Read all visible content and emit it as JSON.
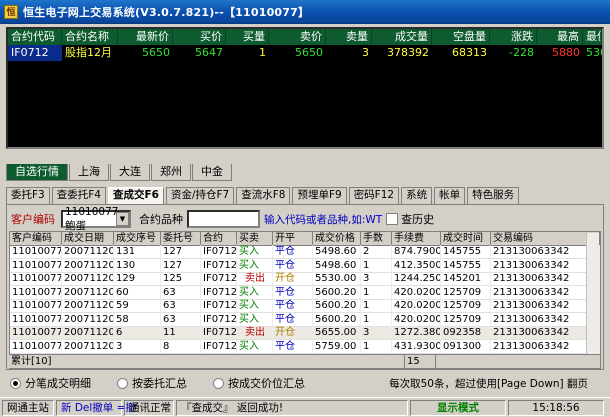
{
  "window": {
    "title": "恒生电子网上交易系统(V3.0.7.821)--【11010077】"
  },
  "quote": {
    "headers": [
      "合约代码",
      "合约名称",
      "最新价",
      "买价",
      "买量",
      "卖价",
      "卖量",
      "成交量",
      "空盘量",
      "涨跌",
      "最高",
      "最低"
    ],
    "row": {
      "code": "IF0712",
      "name": "股指12月",
      "last": "5650",
      "bid": "5647",
      "bid_vol": "1",
      "ask": "5650",
      "ask_vol": "3",
      "volume": "378392",
      "oi": "68313",
      "change": "-228",
      "high": "5880",
      "low": "5305"
    }
  },
  "market_tabs": [
    "自选行情",
    "上海",
    "大连",
    "郑州",
    "中金"
  ],
  "func_tabs": [
    "委托F3",
    "查委托F4",
    "查成交F6",
    "资金/持仓F7",
    "查流水F8",
    "预埋单F9",
    "密码F12",
    "系统",
    "帐单",
    "特色服务"
  ],
  "filter": {
    "customer_label": "客户编码",
    "customer_value": "11010077 鲍蛋",
    "contract_label": "合约品种",
    "contract_value": "",
    "hint": "输入代码或者品种,如:WT",
    "history_label": "查历史"
  },
  "trades": {
    "headers": [
      "客户编码",
      "成交日期",
      "成交序号",
      "委托号",
      "合约",
      "买卖",
      "开平",
      "成交价格",
      "手数",
      "手续费",
      "成交时间",
      "交易编码"
    ],
    "rows": [
      [
        "11010077",
        "20071120",
        "131",
        "127",
        "IF0712",
        "买入",
        "平仓",
        "5498.60",
        "2",
        "874.7900",
        "145755",
        "213130063342"
      ],
      [
        "11010077",
        "20071120",
        "130",
        "127",
        "IF0712",
        "买入",
        "平仓",
        "5498.60",
        "1",
        "412.3500",
        "145755",
        "213130063342"
      ],
      [
        "11010077",
        "20071120",
        "129",
        "125",
        "IF0712",
        "卖出",
        "开仓",
        "5530.00",
        "3",
        "1244.2500",
        "145201",
        "213130063342"
      ],
      [
        "11010077",
        "20071120",
        "60",
        "63",
        "IF0712",
        "买入",
        "平仓",
        "5600.20",
        "1",
        "420.0200",
        "125709",
        "213130063342"
      ],
      [
        "11010077",
        "20071120",
        "59",
        "63",
        "IF0712",
        "买入",
        "平仓",
        "5600.20",
        "1",
        "420.0200",
        "125709",
        "213130063342"
      ],
      [
        "11010077",
        "20071120",
        "58",
        "63",
        "IF0712",
        "买入",
        "平仓",
        "5600.20",
        "1",
        "420.0200",
        "125709",
        "213130063342"
      ],
      [
        "11010077",
        "20071120",
        "6",
        "11",
        "IF0712",
        "卖出",
        "开仓",
        "5655.00",
        "3",
        "1272.3800",
        "092358",
        "213130063342"
      ],
      [
        "11010077",
        "20071120",
        "3",
        "8",
        "IF0712",
        "买入",
        "平仓",
        "5759.00",
        "1",
        "431.9300",
        "091300",
        "213130063342"
      ]
    ],
    "footer": {
      "count": "累计[10]",
      "qty_total": "15"
    }
  },
  "view_options": [
    "分笔成交明细",
    "按委托汇总",
    "按成交价位汇总"
  ],
  "paging_hint": "每次取50条，超过使用[Page Down] 翻页",
  "status": {
    "station": "网通主站",
    "shortcut": "新 Del撤单 =撤",
    "conn": "通讯正常",
    "message": "『查成交』 返回成功!",
    "mode": "显示模式",
    "time": "15:18:56"
  },
  "colors": {
    "accent_green": "#0d5b2e",
    "title_blue": "#0a4fae"
  }
}
